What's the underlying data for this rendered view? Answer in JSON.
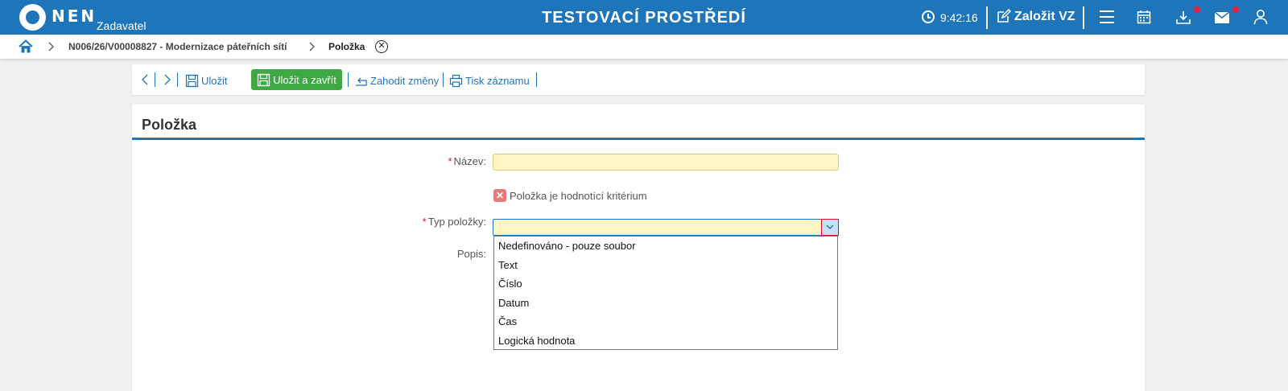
{
  "header": {
    "logo_text": "NEN",
    "logo_sub": "Zadavatel",
    "env_title": "TESTOVACÍ PROSTŘEDÍ",
    "time": "9:42:16",
    "new_vz_label": "Založit VZ",
    "icons": [
      "clock-icon",
      "edit-icon",
      "menu-icon",
      "calendar-icon",
      "download-icon",
      "mail-icon",
      "user-icon"
    ]
  },
  "breadcrumb": {
    "items": [
      "N006/26/V00008827 - Modernizace páteřních sítí"
    ],
    "current": "Položka"
  },
  "toolbar": {
    "save_label": "Uložit",
    "save_close_label": "Uložit a zavřít",
    "discard_label": "Zahodit změny",
    "print_label": "Tisk záznamu"
  },
  "form": {
    "title": "Položka",
    "name_label": "Název:",
    "name_value": "",
    "criterion_label": "Položka je hodnotící kritérium",
    "type_label": "Typ položky:",
    "type_value": "",
    "desc_label": "Popis:",
    "type_options": [
      "Nedefinováno - pouze soubor",
      "Text",
      "Číslo",
      "Datum",
      "Čas",
      "Logická hodnota"
    ]
  },
  "colors": {
    "primary": "#1f75b9",
    "success": "#3fa843",
    "field_bg": "#fdf6c3",
    "required": "#d9141a"
  }
}
